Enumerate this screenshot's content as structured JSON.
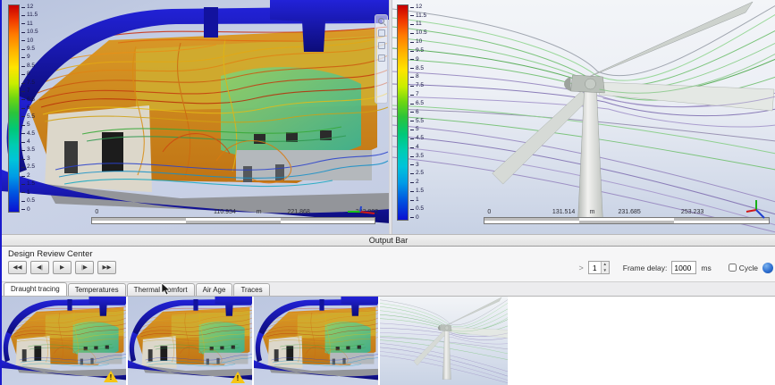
{
  "output_bar": {
    "label": "Output Bar"
  },
  "review_center": {
    "title": "Design Review Center",
    "playback": [
      {
        "name": "jump-to-start-button",
        "glyph": "◀◀"
      },
      {
        "name": "step-back-button",
        "glyph": "◀|"
      },
      {
        "name": "play-button",
        "glyph": "▶"
      },
      {
        "name": "step-forward-button",
        "glyph": "|▶"
      },
      {
        "name": "jump-to-end-button",
        "glyph": "▶▶"
      }
    ],
    "expander_glyph": ">",
    "frame_number": "1",
    "spinner_up_glyph": "▲",
    "spinner_down_glyph": "▼",
    "frame_delay_label": "Frame delay:",
    "frame_delay_value": "1000",
    "frame_delay_unit": "ms",
    "cycle_label": "Cycle"
  },
  "tabs": [
    {
      "label": "Draught tracing"
    },
    {
      "label": "Temperatures"
    },
    {
      "label": "Thermal Comfort"
    },
    {
      "label": "Air Age"
    },
    {
      "label": "Traces"
    }
  ],
  "legend": {
    "ticks": [
      "12",
      "11.5",
      "11",
      "10.5",
      "10",
      "9.5",
      "9",
      "8.5",
      "8",
      "7.5",
      "7",
      "6.5",
      "6",
      "5.5",
      "5",
      "4.5",
      "4",
      "3.5",
      "3",
      "2.5",
      "2",
      "1.5",
      "1",
      "0.5",
      "0"
    ]
  },
  "left_viewport": {
    "ruler_labels": [
      "0",
      "110.934",
      "m",
      "221.868",
      "332.802"
    ]
  },
  "right_viewport": {
    "ruler_labels": [
      "0",
      "131.514",
      "m",
      "231.685",
      "253.233"
    ]
  },
  "thumbnails": {
    "warning_glyph": "!"
  },
  "colors": {
    "legend_max": "#c80000",
    "legend_min": "#0a10d2",
    "shell_blue": "#12129e",
    "streamline_green": "#7cc47c",
    "streamline_purple": "#9d8fc4"
  }
}
